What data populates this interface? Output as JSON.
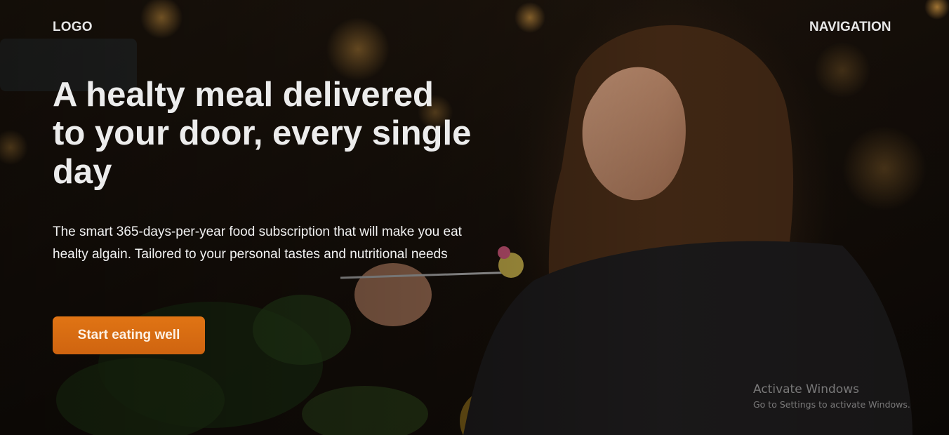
{
  "header": {
    "logo": "LOGO",
    "nav_label": "NAVIGATION"
  },
  "hero": {
    "headline": "A healty meal delivered to your door, every single day",
    "description": "The smart 365-days-per-year food subscription that will make you eat healty algain. Tailored to your personal tastes and nutritional needs",
    "cta_label": "Start eating well",
    "background_image": "woman-eating-pasta-photo"
  },
  "colors": {
    "cta": "#d86a12",
    "text": "#ececec",
    "background": "#120d08"
  },
  "os_watermark": {
    "title": "Activate Windows",
    "subtitle": "Go to Settings to activate Windows."
  }
}
